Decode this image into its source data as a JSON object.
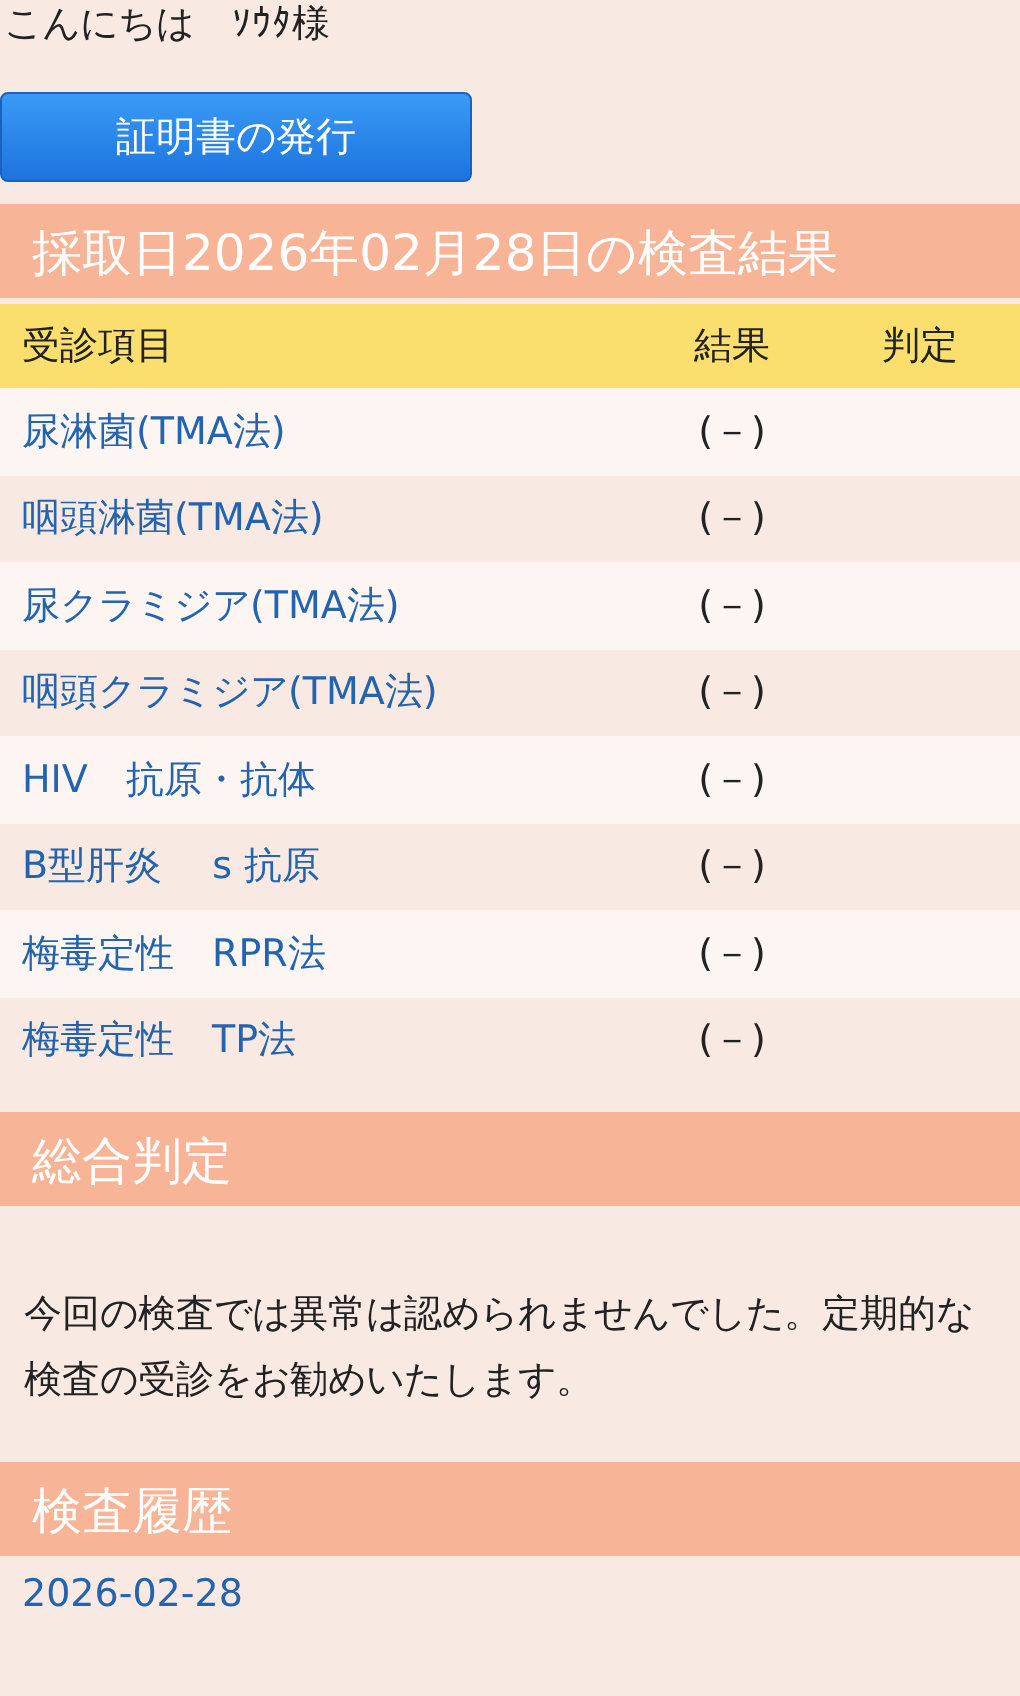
{
  "greeting": "こんにちは　ｿｳﾀ様",
  "certificate_button": "証明書の発行",
  "results_section": {
    "title": "採取日2026年02月28日の検査結果",
    "columns": [
      "受診項目",
      "結果",
      "判定"
    ],
    "rows": [
      {
        "item": "尿淋菌(TMA法)",
        "result": "(－)"
      },
      {
        "item": "咽頭淋菌(TMA法)",
        "result": "(－)"
      },
      {
        "item": "尿クラミジア(TMA法)",
        "result": "(－)"
      },
      {
        "item": "咽頭クラミジア(TMA法)",
        "result": "(－)"
      },
      {
        "item": "HIV　抗原・抗体",
        "result": "(－)"
      },
      {
        "item": "B型肝炎　 s 抗原",
        "result": "(－)"
      },
      {
        "item": "梅毒定性　RPR法",
        "result": "(－)"
      },
      {
        "item": "梅毒定性　TP法",
        "result": "(－)"
      }
    ]
  },
  "summary_section": {
    "title": "総合判定",
    "text": "今回の検査では異常は認められませんでした。定期的な検査の受診をお勧めいたします。"
  },
  "history_section": {
    "title": "検査履歴",
    "items": [
      "2026-02-28"
    ]
  }
}
